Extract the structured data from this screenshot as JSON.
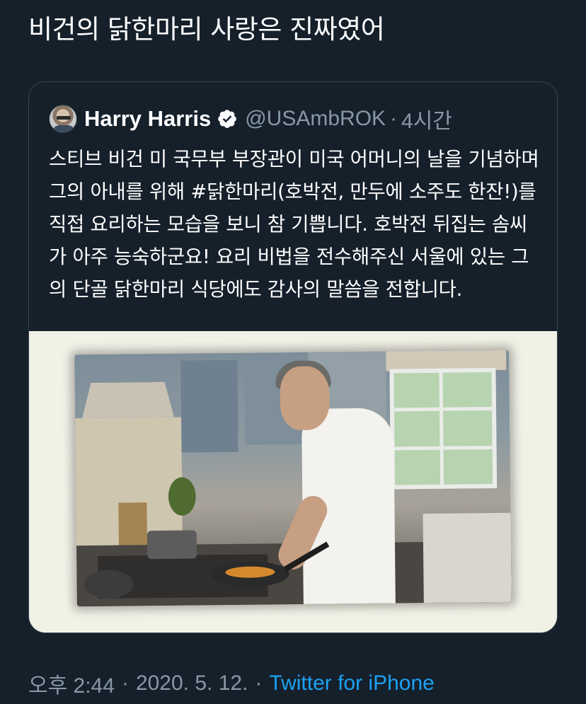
{
  "tweet": {
    "text": "비건의 닭한마리 사랑은 진짜였어"
  },
  "quoted_tweet": {
    "display_name": "Harry Harris",
    "verified": true,
    "handle": "@USAmbROK",
    "separator": "·",
    "time_ago": "4시간",
    "body": "스티브 비건 미 국무부 부장관이 미국 어머니의 날을 기념하며 그의 아내를 위해 #닭한마리(호박전, 만두에 소주도 한잔!)를 직접 요리하는 모습을 보니 참 기쁩니다. 호박전 뒤집는 솜씨가 아주 능숙하군요! 요리 비법을 전수해주신 서울에 있는 그의 단골 닭한마리 식당에도 감사의 말씀을 전합니다."
  },
  "meta": {
    "time": "오후 2:44",
    "sep1": "·",
    "date": "2020. 5. 12.",
    "sep2": "·",
    "source": "Twitter for iPhone"
  },
  "colors": {
    "background": "#15202b",
    "border": "#38444d",
    "secondary_text": "#8899a6",
    "link": "#1da1f2",
    "verified_badge": "#ffffff"
  },
  "icons": {
    "verified": "verified-badge-icon"
  }
}
